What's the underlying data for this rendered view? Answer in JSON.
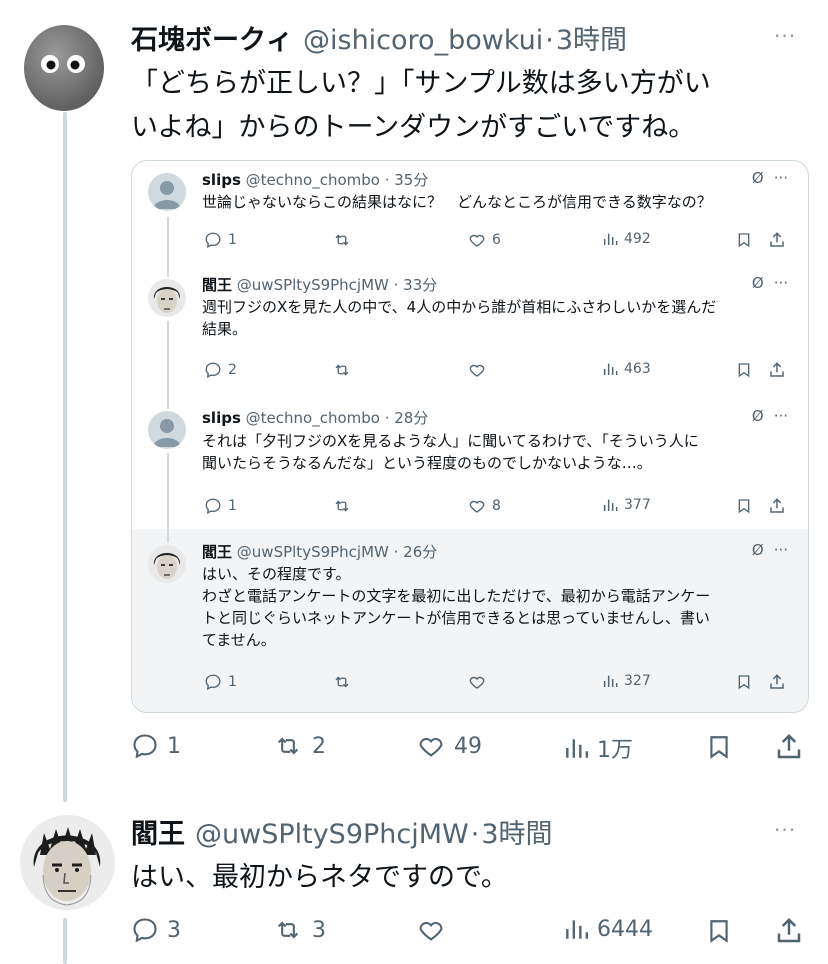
{
  "post1": {
    "name": "石塊ボークィ",
    "handle": "@ishicoro_bowkui",
    "sep": "·",
    "time": "3時間",
    "more": "···",
    "text_line1": "「どちらが正しい？」「サンプル数は多い方がい",
    "text_line2": "いよね」からのトーンダウンがすごいですね。",
    "replies": "1",
    "reposts": "2",
    "likes": "49",
    "views": "1万"
  },
  "quote": {
    "tweets": [
      {
        "name": "slips",
        "handle": "@techno_chombo · 35分",
        "lines": [
          "世論じゃないならこの結果はなに？　どんなところが信用できる数字なの？"
        ],
        "replies": "1",
        "reposts": "",
        "likes": "6",
        "views": "492"
      },
      {
        "name": "閻王",
        "handle": "@uwSPltyS9PhcjMW · 33分",
        "lines": [
          "週刊フジのXを見た人の中で、4人の中から誰が首相にふさわしいかを選んだ",
          "結果。"
        ],
        "replies": "2",
        "reposts": "",
        "likes": "",
        "views": "463"
      },
      {
        "name": "slips",
        "handle": "@techno_chombo · 28分",
        "lines": [
          "それは「夕刊フジのXを見るような人」に聞いてるわけで、「そういう人に",
          "聞いたらそうなるんだな」という程度のものでしかないような…。"
        ],
        "replies": "1",
        "reposts": "",
        "likes": "8",
        "views": "377"
      },
      {
        "name": "閻王",
        "handle": "@uwSPltyS9PhcjMW · 26分",
        "lines": [
          "はい、その程度です。",
          "わざと電話アンケートの文字を最初に出しただけで、最初から電話アンケー",
          "トと同じぐらいネットアンケートが信用できるとは思っていませんし、書い",
          "てません。"
        ],
        "replies": "1",
        "reposts": "",
        "likes": "",
        "views": "327"
      }
    ]
  },
  "post2": {
    "name": "閻王",
    "handle": "@uwSPltyS9PhcjMW",
    "sep": "·",
    "time": "3時間",
    "more": "···",
    "text": "はい、最初からネタですので。",
    "replies": "3",
    "reposts": "3",
    "likes": "",
    "views": "6444"
  },
  "colors": {
    "text": "#0f1419",
    "secondary": "#536471",
    "border": "#cfd9de",
    "highlight": "#f2f4f5"
  }
}
